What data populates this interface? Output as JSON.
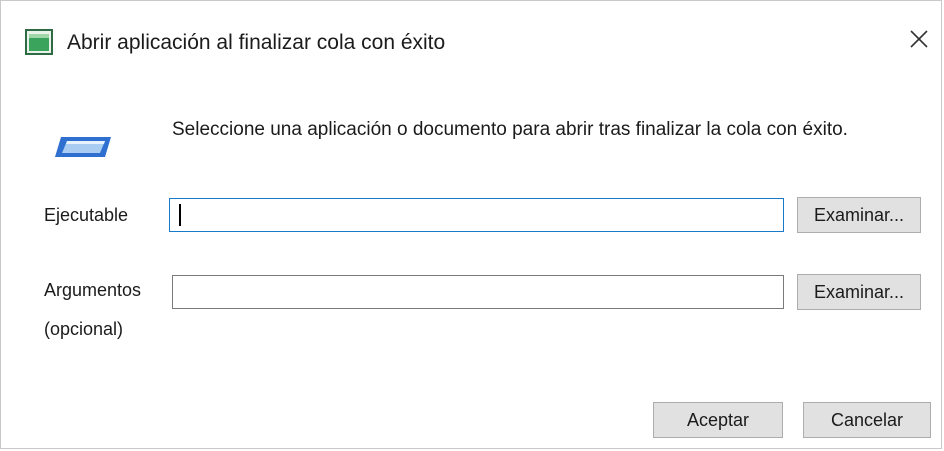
{
  "dialog": {
    "title": "Abrir aplicación al finalizar cola con éxito",
    "app_icon": "app-window-icon",
    "close_icon": "close-icon"
  },
  "intro": {
    "icon": "application-window-icon",
    "text": "Seleccione una aplicación o documento para abrir tras finalizar la cola con éxito."
  },
  "executable": {
    "label": "Ejecutable",
    "value": "",
    "browse_label": "Examinar..."
  },
  "arguments": {
    "label_line1": "Argumentos",
    "label_line2": "(opcional)",
    "value": "",
    "browse_label": "Examinar..."
  },
  "footer": {
    "ok_label": "Aceptar",
    "cancel_label": "Cancelar"
  },
  "colors": {
    "focus_border": "#1979ca",
    "button_face": "#e1e1e1",
    "icon_green": "#2e8b57",
    "icon_blue": "#2f6fd0"
  }
}
